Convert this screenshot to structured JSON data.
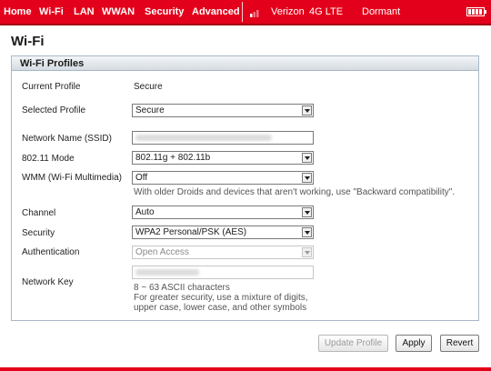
{
  "header": {
    "nav": [
      "Home",
      "Wi-Fi",
      "LAN",
      "WWAN",
      "Security",
      "Advanced"
    ],
    "carrier": "Verizon",
    "network": "4G LTE",
    "status": "Dormant",
    "signal_icon": "signal-icon",
    "battery_icon": "battery-icon"
  },
  "page": {
    "title": "Wi-Fi"
  },
  "panel": {
    "title": "Wi-Fi Profiles"
  },
  "form": {
    "current_profile": {
      "label": "Current Profile",
      "value": "Secure"
    },
    "selected_profile": {
      "label": "Selected Profile",
      "value": "Secure"
    },
    "ssid": {
      "label": "Network Name (SSID)"
    },
    "mode": {
      "label": "802.11 Mode",
      "value": "802.11g + 802.11b"
    },
    "wmm": {
      "label": "WMM (Wi-Fi Multimedia)",
      "value": "Off",
      "hint": "With older Droids and devices that aren't working, use \"Backward compatibility\"."
    },
    "channel": {
      "label": "Channel",
      "value": "Auto"
    },
    "security": {
      "label": "Security",
      "value": "WPA2 Personal/PSK (AES)"
    },
    "authentication": {
      "label": "Authentication",
      "value": "Open Access"
    },
    "network_key": {
      "label": "Network Key",
      "hint1": "8 ~ 63 ASCII characters",
      "hint2": "For greater security, use a mixture of digits,",
      "hint3": "upper case, lower case, and other symbols"
    }
  },
  "buttons": {
    "update": "Update Profile",
    "apply": "Apply",
    "revert": "Revert"
  },
  "colors": {
    "brand": "#e3001b",
    "panel_border": "#a9b7c6"
  }
}
